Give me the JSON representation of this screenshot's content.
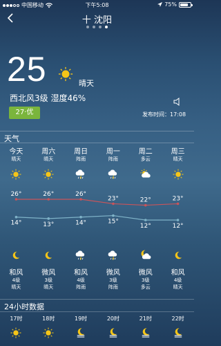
{
  "status_bar": {
    "carrier": "中国移动",
    "time": "下午5:08",
    "battery": "75%",
    "battery_level": 0.75
  },
  "header": {
    "city": "十 沈阳",
    "back_icon": "chevron-left-icon",
    "pages": 4,
    "active_page": 4
  },
  "current": {
    "temperature": "25",
    "condition": "晴天",
    "wind_humidity": "西北风3级 湿度46%",
    "aqi": "27·优",
    "aqi_color": "#7ab53c",
    "publish_time": "发布时间：17:08"
  },
  "forecast": {
    "title": "天气",
    "days": [
      {
        "day": "今天",
        "desc": "晴天",
        "icon": "sun",
        "high": "26°",
        "high_val": 26,
        "low": "14°",
        "low_val": 14,
        "night_icon": "moon",
        "wind": "和风",
        "level": "4级",
        "night_desc": "晴天"
      },
      {
        "day": "周六",
        "desc": "晴天",
        "icon": "sun",
        "high": "26°",
        "high_val": 26,
        "low": "13°",
        "low_val": 13,
        "night_icon": "moon",
        "wind": "微风",
        "level": "3级",
        "night_desc": "晴天"
      },
      {
        "day": "周日",
        "desc": "阵雨",
        "icon": "rain",
        "high": "26°",
        "high_val": 26,
        "low": "14°",
        "low_val": 14,
        "night_icon": "rain",
        "wind": "和风",
        "level": "4级",
        "night_desc": "阵雨"
      },
      {
        "day": "周一",
        "desc": "阵雨",
        "icon": "rain",
        "high": "23°",
        "high_val": 23,
        "low": "15°",
        "low_val": 15,
        "night_icon": "rain",
        "wind": "微风",
        "level": "3级",
        "night_desc": "阵雨"
      },
      {
        "day": "周二",
        "desc": "多云",
        "icon": "cloud-sun",
        "high": "22°",
        "high_val": 22,
        "low": "12°",
        "low_val": 12,
        "night_icon": "cloud-moon",
        "wind": "微风",
        "level": "3级",
        "night_desc": "多云"
      },
      {
        "day": "周三",
        "desc": "晴天",
        "icon": "sun",
        "high": "23°",
        "high_val": 23,
        "low": "12°",
        "low_val": 12,
        "night_icon": "moon",
        "wind": "和风",
        "level": "4级",
        "night_desc": "晴天"
      }
    ]
  },
  "hourly": {
    "title": "24小时数据",
    "hours": [
      {
        "time": "17时",
        "icon": "sun"
      },
      {
        "time": "18时",
        "icon": "sun"
      },
      {
        "time": "19时",
        "icon": "moon-fog"
      },
      {
        "time": "20时",
        "icon": "moon-fog"
      },
      {
        "time": "21时",
        "icon": "moon-fog"
      },
      {
        "time": "22时",
        "icon": "moon-fog"
      }
    ]
  },
  "colors": {
    "high_line": "#c9545a",
    "low_line": "#7fb3c8",
    "sun": "#f5c518"
  }
}
